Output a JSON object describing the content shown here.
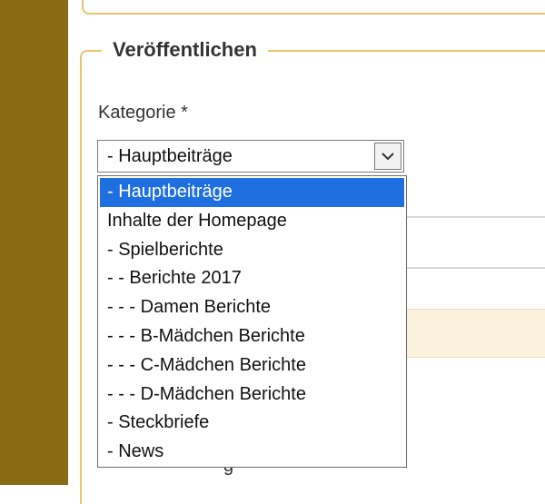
{
  "section": {
    "legend": "Veröffentlichen"
  },
  "field": {
    "label": "Kategorie *"
  },
  "select": {
    "value": "- Hauptbeiträge",
    "arrow_icon": "chevron-down-icon"
  },
  "options": [
    {
      "label": "- Hauptbeiträge",
      "selected": true
    },
    {
      "label": "Inhalte der Homepage",
      "selected": false
    },
    {
      "label": "- Spielberichte",
      "selected": false
    },
    {
      "label": "- - Berichte 2017",
      "selected": false
    },
    {
      "label": "- - - Damen Berichte",
      "selected": false
    },
    {
      "label": "- - - B-Mädchen Berichte",
      "selected": false
    },
    {
      "label": "- - - C-Mädchen Berichte",
      "selected": false
    },
    {
      "label": "- - - D-Mädchen Berichte",
      "selected": false
    },
    {
      "label": "- Steckbriefe",
      "selected": false
    },
    {
      "label": "- News",
      "selected": false
    }
  ],
  "background": {
    "partial_text": "g"
  },
  "colors": {
    "sidebar": "#8a6a14",
    "border_accent": "#e8c56c",
    "selection": "#1f6fe0"
  }
}
